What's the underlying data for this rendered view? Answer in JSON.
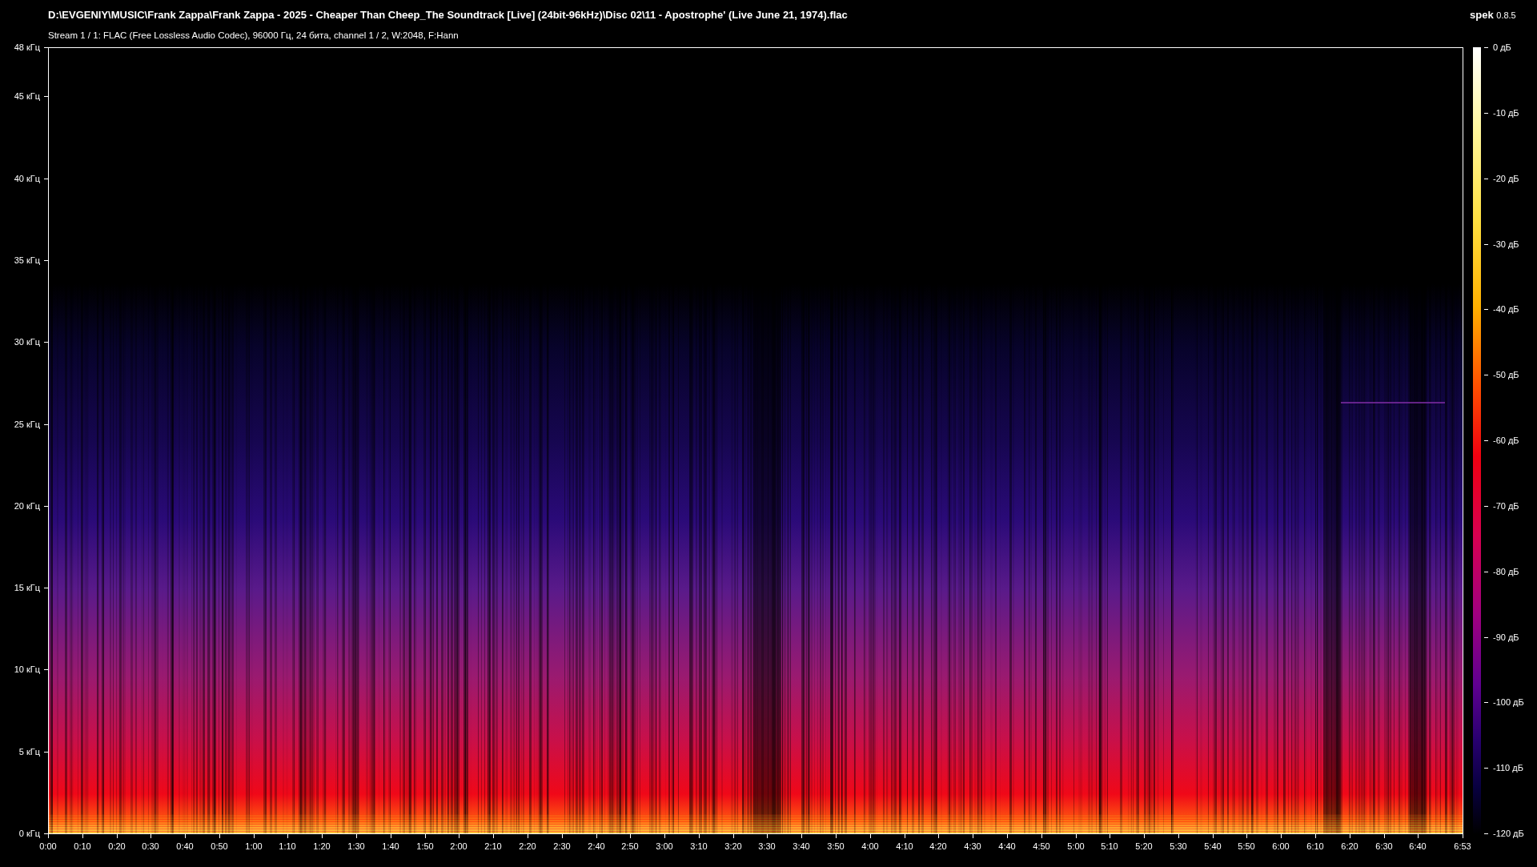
{
  "title": "D:\\EVGENIY\\MUSIC\\Frank Zappa\\Frank Zappa - 2025 - Cheaper Than Cheep_The Soundtrack [Live] (24bit-96kHz)\\Disc 02\\11 - Apostrophe' (Live June 21, 1974).flac",
  "app": {
    "name": "spek",
    "version": "0.8.5"
  },
  "stream_info": "Stream 1 / 1: FLAC (Free Lossless Audio Codec), 96000 Гц, 24 бита, channel 1 / 2, W:2048, F:Hann",
  "frequency_axis": [
    "48 кГц",
    "45 кГц",
    "40 кГц",
    "35 кГц",
    "30 кГц",
    "25 кГц",
    "20 кГц",
    "15 кГц",
    "10 кГц",
    "5 кГц",
    "0 кГц"
  ],
  "time_axis": [
    "0:00",
    "0:10",
    "0:20",
    "0:30",
    "0:40",
    "0:50",
    "1:00",
    "1:10",
    "1:20",
    "1:30",
    "1:40",
    "1:50",
    "2:00",
    "2:10",
    "2:20",
    "2:30",
    "2:40",
    "2:50",
    "3:00",
    "3:10",
    "3:20",
    "3:30",
    "3:40",
    "3:50",
    "4:00",
    "4:10",
    "4:20",
    "4:30",
    "4:40",
    "4:50",
    "5:00",
    "5:10",
    "5:20",
    "5:30",
    "5:40",
    "5:50",
    "6:00",
    "6:10",
    "6:20",
    "6:30",
    "6:40",
    "6:53"
  ],
  "db_scale": [
    "0 дБ",
    "-10 дБ",
    "-20 дБ",
    "-30 дБ",
    "-40 дБ",
    "-50 дБ",
    "-60 дБ",
    "-70 дБ",
    "-80 дБ",
    "-90 дБ",
    "-100 дБ",
    "-110 дБ",
    "-120 дБ"
  ]
}
